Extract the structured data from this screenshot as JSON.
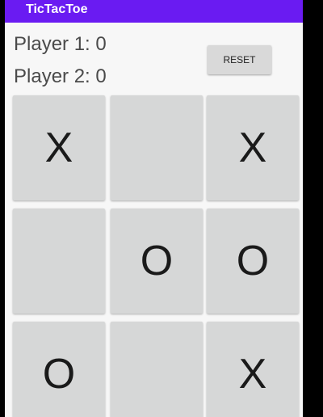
{
  "app": {
    "title": "TicTacToe",
    "colors": {
      "appbar": "#6a1bf2",
      "background": "#f7f7f7",
      "cell": "#d6d7d7"
    }
  },
  "scores": {
    "player1": "Player 1: 0",
    "player2": "Player 2: 0"
  },
  "controls": {
    "reset_label": "RESET"
  },
  "board": {
    "cells": [
      [
        "X",
        "",
        "X"
      ],
      [
        "",
        "O",
        "O"
      ],
      [
        "O",
        "",
        "X"
      ]
    ]
  }
}
